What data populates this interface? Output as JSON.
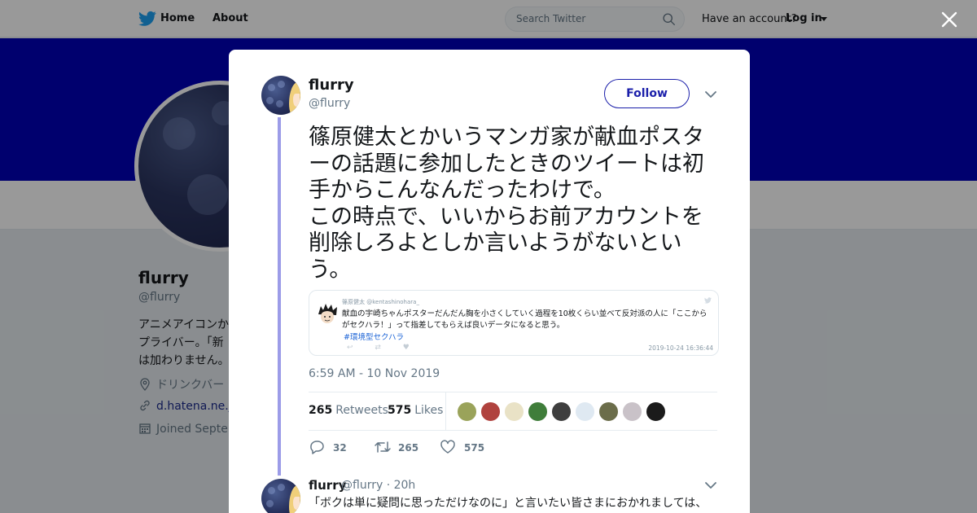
{
  "topbar": {
    "home_label": "Home",
    "about_label": "About",
    "search_placeholder": "Search Twitter",
    "account_prompt": "Have an account?",
    "login_label": "Log in",
    "brand_color": "#1da1f2"
  },
  "profile": {
    "banner_color": "#0000b8",
    "name": "flurry",
    "handle": "@flurry",
    "bio_lines": [
      "アニメアイコンか",
      "プライバー。「新",
      "は加わりません。"
    ],
    "location": "ドリンクバー",
    "link": "d.hatena.ne.jp",
    "joined": "Joined Septen"
  },
  "modal": {
    "author": {
      "name": "flurry",
      "handle": "@flurry"
    },
    "follow_label": "Follow",
    "accent_color": "#1b1faa",
    "thread_color": "#9c9ce8",
    "text": "篠原健太とかいうマンガ家が献血ポスターの話題に参加したときのツイートは初手からこんなんだったわけで。\nこの時点で、いいからお前アカウントを削除しろよとしか言いようがないという。",
    "embedded": {
      "header": "篠原健太 @kentashinohara_",
      "body": "献血の宇崎ちゃんポスターだんだん胸を小さくしていく過程を10枚くらい並べて反対派の人に「ここから\nがセクハラ！」って指差してもらえば良いデータになると思う。",
      "hashtag": "#環境型セクハラ",
      "timestamp": "2019-10-24 16:36:44",
      "action_glyphs": "↩ ⇄ ♥"
    },
    "timestamp": "6:59 AM - 10 Nov 2019",
    "retweets": {
      "count": "265",
      "label": "Retweets"
    },
    "likes": {
      "count": "575",
      "label": "Likes"
    },
    "likers": [
      {
        "name": "liker-1-avatar",
        "color": "#9aa35a"
      },
      {
        "name": "liker-2-avatar",
        "color": "#b0423e"
      },
      {
        "name": "liker-3-avatar",
        "color": "#e9e2c6"
      },
      {
        "name": "liker-4-avatar",
        "color": "#3f7d3a"
      },
      {
        "name": "liker-5-avatar",
        "color": "#3e3e3e"
      },
      {
        "name": "liker-6-avatar",
        "color": "#dfe9f2"
      },
      {
        "name": "liker-7-avatar",
        "color": "#6b6d4a"
      },
      {
        "name": "liker-8-avatar",
        "color": "#c9c2c8"
      },
      {
        "name": "liker-9-avatar",
        "color": "#1b1b1b"
      }
    ],
    "actions": {
      "replies": "32",
      "retweets": "265",
      "likes": "575"
    },
    "reply": {
      "name": "flurry",
      "meta": "@flurry · 20h",
      "text": "「ボクは単に疑問に思っただけなのに」と言いたい皆さまにおかれましては、"
    }
  }
}
